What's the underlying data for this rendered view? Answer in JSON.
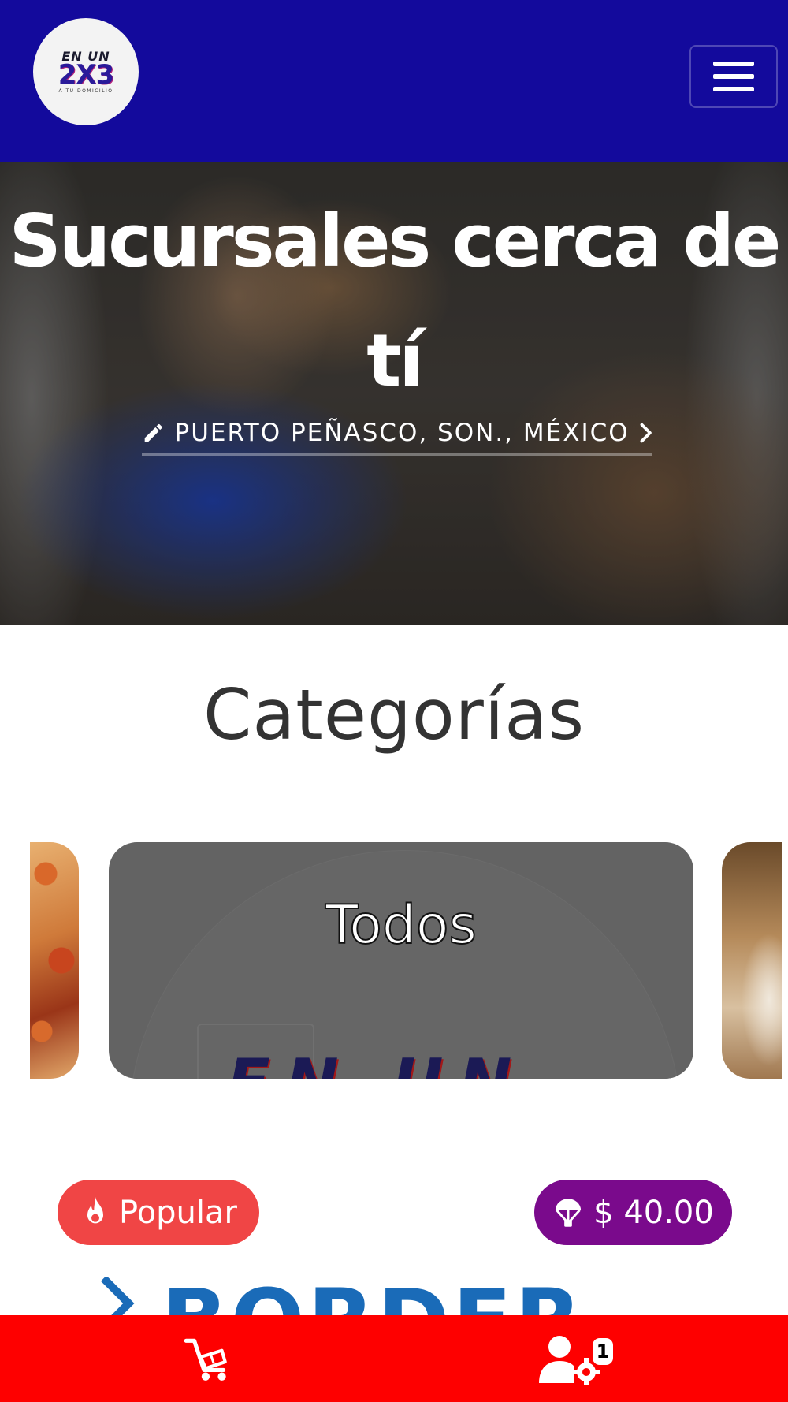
{
  "header": {
    "logo": {
      "line1": "EN UN",
      "line2": "2X3",
      "line3": "A TU DOMICILIO"
    },
    "menu_icon": "hamburger-menu-icon"
  },
  "hero": {
    "title": "Sucursales cerca de tí",
    "location_icon": "pencil-icon",
    "location": "PUERTO PEÑASCO, SON., MÉXICO",
    "location_chevron": "chevron-right-icon"
  },
  "categories": {
    "title": "Categorías",
    "selected_label": "Todos"
  },
  "product": {
    "popular_label": "Popular",
    "popular_icon": "fire-icon",
    "price": "$ 40.00",
    "price_icon": "parachute-icon"
  },
  "bottom_nav": {
    "cart_icon": "cart-icon",
    "user_icon": "user-settings-icon",
    "notification_count": "1"
  },
  "colors": {
    "header_bg": "#130a9c",
    "popular_badge": "#f04545",
    "price_badge": "#7a0a8c",
    "bottom_bar": "#fe0000",
    "category_card": "#636363"
  }
}
